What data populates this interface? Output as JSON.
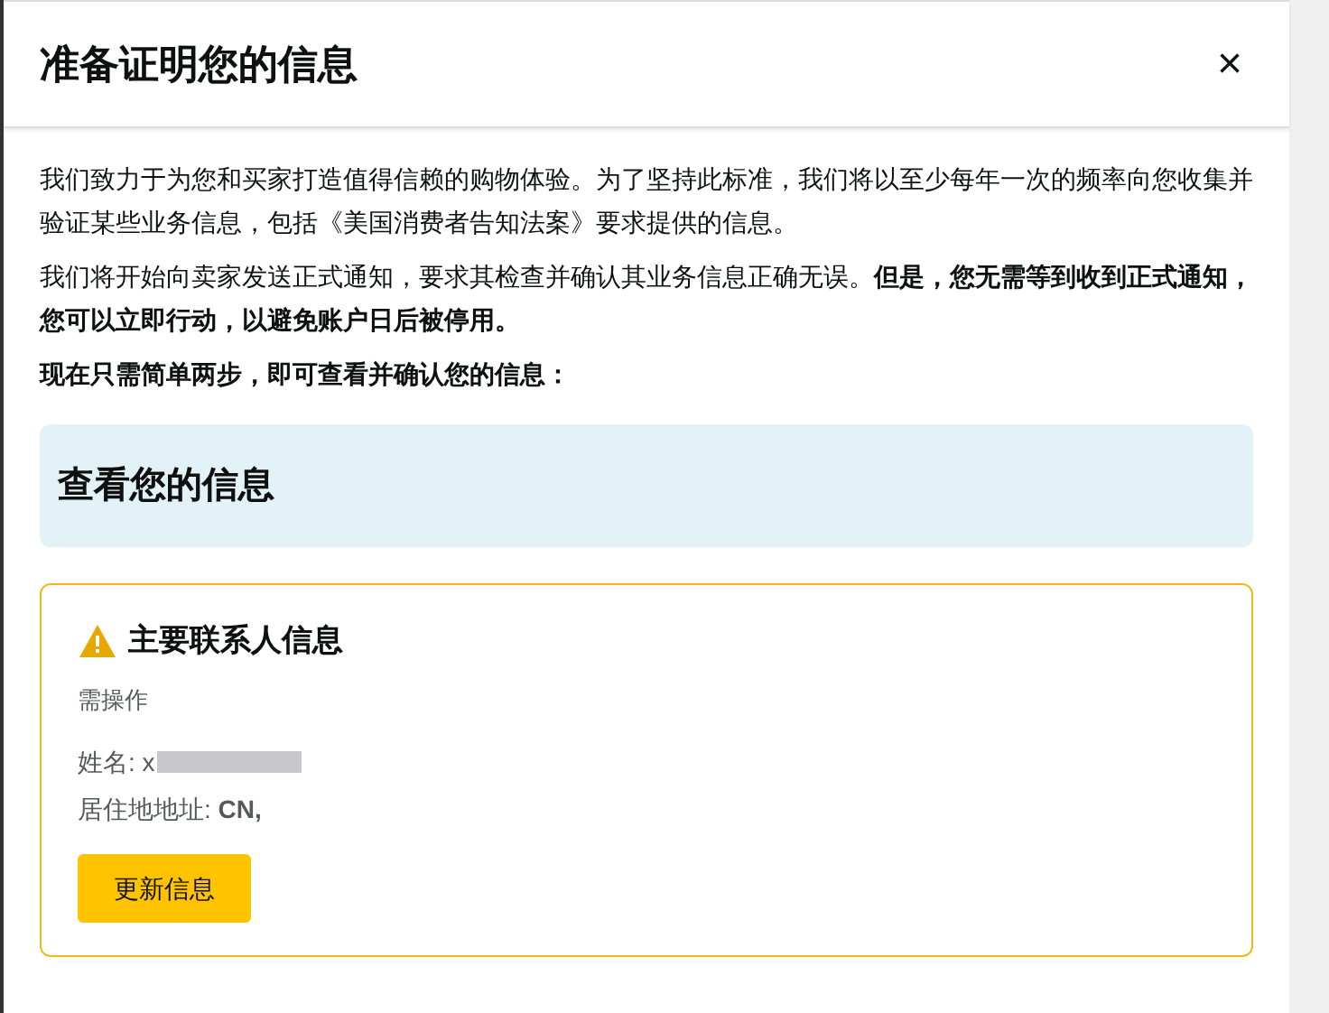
{
  "dialog": {
    "title": "准备证明您的信息",
    "close": "×"
  },
  "paragraphs": [
    "我们致力于为您和买家打造值得信赖的购物体验。为了坚持此标准，我们将以至少每年一次的频率向您收集并验证某些业务信息，包括《美国消费者告知法案》要求提供的信息。",
    "我们将开始向卖家发送正式通知，要求其检查并确认其业务信息正确无误。**但是，您无需等到收到正式通知，您可以立即行动，以避免账户日后被停用。**"
  ],
  "steps_intro": "现在只需简单两步，即可查看并确认您的信息：",
  "review_banner": {
    "title": "查看您的信息"
  },
  "card": {
    "title": "主要联系人信息",
    "status": "需操作",
    "fields": [
      {
        "text": "姓名: x",
        "redacted": true
      },
      {
        "text": "居住地地址: **CN,**",
        "redacted": false
      }
    ],
    "button": "更新信息"
  }
}
